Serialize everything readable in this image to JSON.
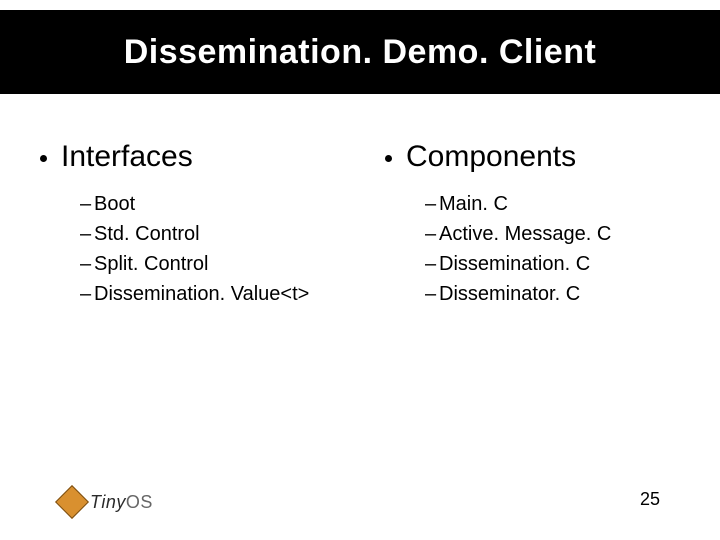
{
  "title": "Dissemination. Demo. Client",
  "columns": [
    {
      "heading": "Interfaces",
      "items": [
        "Boot",
        "Std. Control",
        "Split. Control",
        "Dissemination. Value<t>"
      ]
    },
    {
      "heading": "Components",
      "items": [
        "Main. C",
        "Active. Message. C",
        "Dissemination. C",
        "Disseminator. C"
      ]
    }
  ],
  "logo": {
    "part1": "Tiny",
    "part2": "OS"
  },
  "page_number": "25"
}
